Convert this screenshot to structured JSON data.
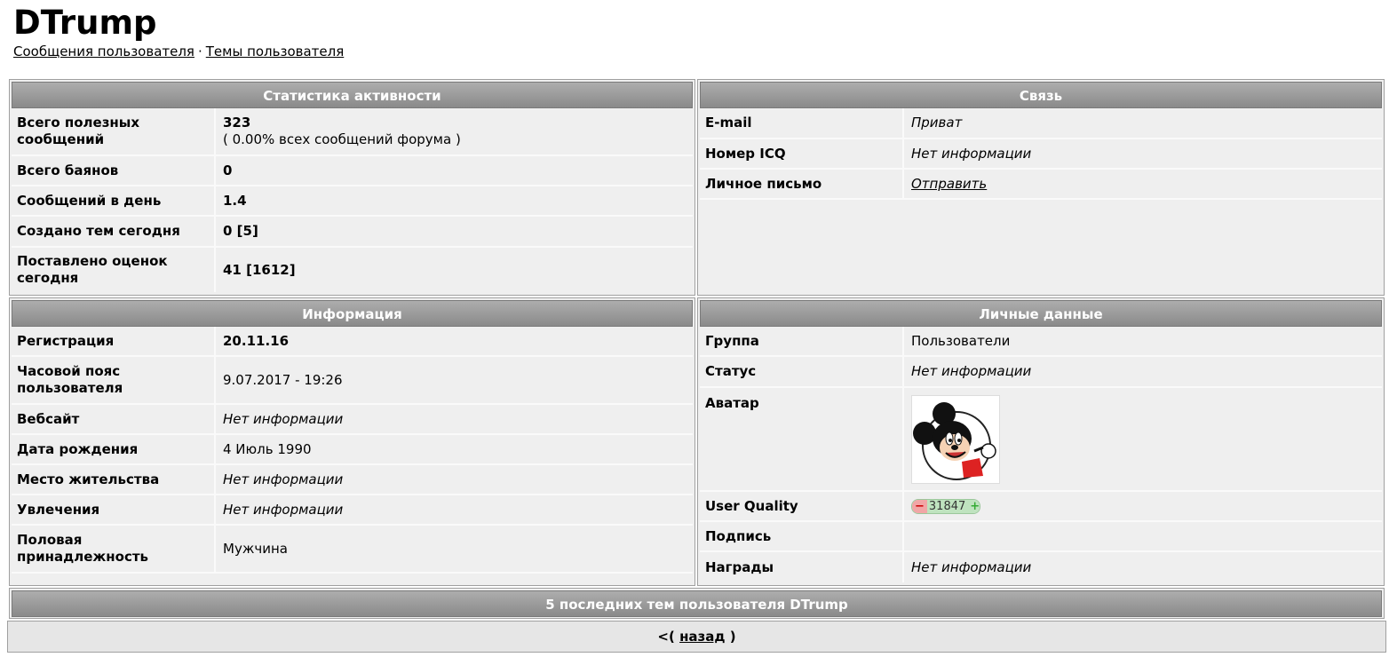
{
  "title": "DTrump",
  "links": {
    "posts": "Сообщения пользователя",
    "separator": "·",
    "topics": "Темы пользователя"
  },
  "activity": {
    "header": "Статистика активности",
    "total_useful_label": "Всего полезных сообщений",
    "total_useful_value": "323",
    "total_useful_sub": "( 0.00% всех сообщений форума )",
    "bayans_label": "Всего баянов",
    "bayans_value": "0",
    "per_day_label": "Сообщений в день",
    "per_day_value": "1.4",
    "topics_today_label": "Создано тем сегодня",
    "topics_today_value": "0 [5]",
    "ratings_today_label": "Поставлено оценок сегодня",
    "ratings_today_value": "41 [1612]"
  },
  "contact": {
    "header": "Связь",
    "email_label": "E-mail",
    "email_value": "Приват",
    "icq_label": "Номер ICQ",
    "icq_value": "Нет информации",
    "pm_label": "Личное письмо",
    "pm_value": "Отправить"
  },
  "info": {
    "header": "Информация",
    "reg_label": "Регистрация",
    "reg_value": "20.11.16",
    "tz_label": "Часовой пояс пользователя",
    "tz_value": "9.07.2017 - 19:26",
    "web_label": "Вебсайт",
    "web_value": "Нет информации",
    "birth_label": "Дата рождения",
    "birth_value": "4 Июль 1990",
    "location_label": "Место жительства",
    "location_value": "Нет информации",
    "hobbies_label": "Увлечения",
    "hobbies_value": "Нет информации",
    "gender_label": "Половая принадлежность",
    "gender_value": "Мужчина"
  },
  "personal": {
    "header": "Личные данные",
    "group_label": "Группа",
    "group_value": "Пользователи",
    "status_label": "Статус",
    "status_value": "Нет информации",
    "avatar_label": "Аватар",
    "uq_label": "User Quality",
    "uq_minus": "−",
    "uq_value": "31847",
    "uq_plus": "+",
    "signature_label": "Подпись",
    "awards_label": "Награды",
    "awards_value": "Нет информации"
  },
  "recent_topics_header": "5 последних тем пользователя DTrump",
  "back": {
    "prefix": "<(",
    "link": "назад",
    "suffix": ")"
  }
}
